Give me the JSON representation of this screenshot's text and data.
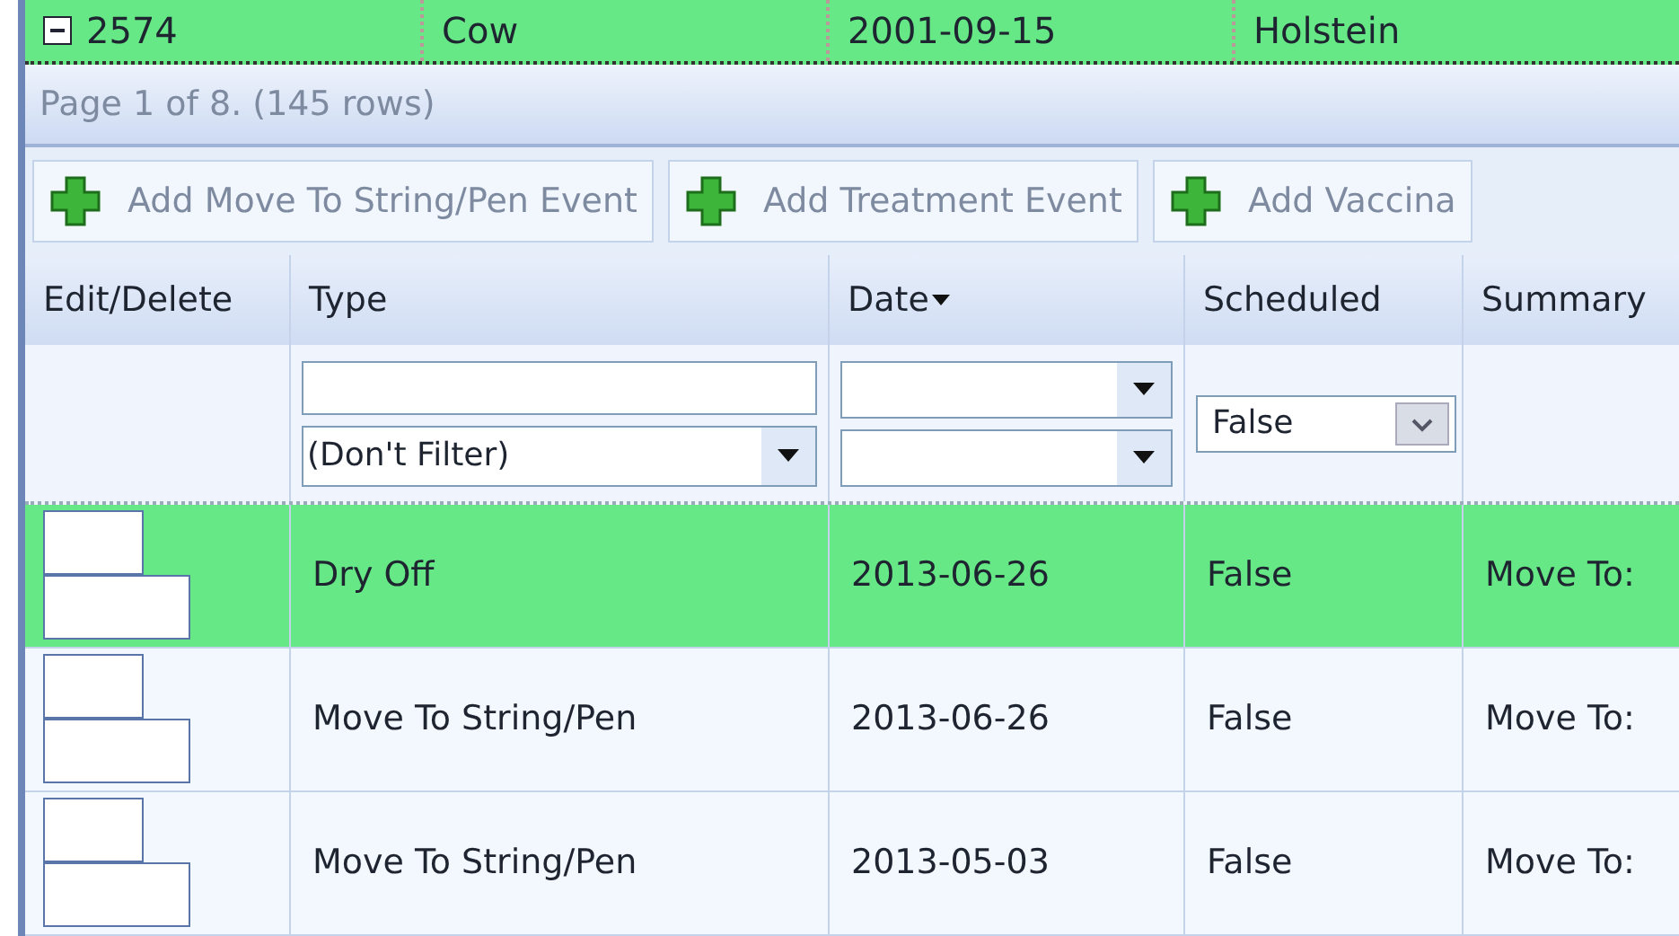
{
  "parent_row": {
    "expanded": true,
    "cells": [
      "2574",
      "Cow",
      "2001-09-15",
      "Holstein"
    ]
  },
  "pager": {
    "summary": "Page 1 of 8. (145 rows)"
  },
  "toolbar": [
    "Add Move To String/Pen Event",
    "Add Treatment Event",
    "Add Vaccina"
  ],
  "columns": [
    {
      "label": "Edit/Delete",
      "sorted": false
    },
    {
      "label": "Type",
      "sorted": false
    },
    {
      "label": "Date",
      "sorted": true
    },
    {
      "label": "Scheduled",
      "sorted": false
    },
    {
      "label": "Summary",
      "sorted": false
    }
  ],
  "filters": {
    "type_select": "(Don't Filter)",
    "scheduled": "False"
  },
  "rows": [
    {
      "type": "Dry Off",
      "date": "2013-06-26",
      "scheduled": "False",
      "summary": "Move To:",
      "selected": true
    },
    {
      "type": "Move To String/Pen",
      "date": "2013-06-26",
      "scheduled": "False",
      "summary": "Move To:",
      "selected": false
    },
    {
      "type": "Move To String/Pen",
      "date": "2013-05-03",
      "scheduled": "False",
      "summary": "Move To:",
      "selected": false
    }
  ]
}
